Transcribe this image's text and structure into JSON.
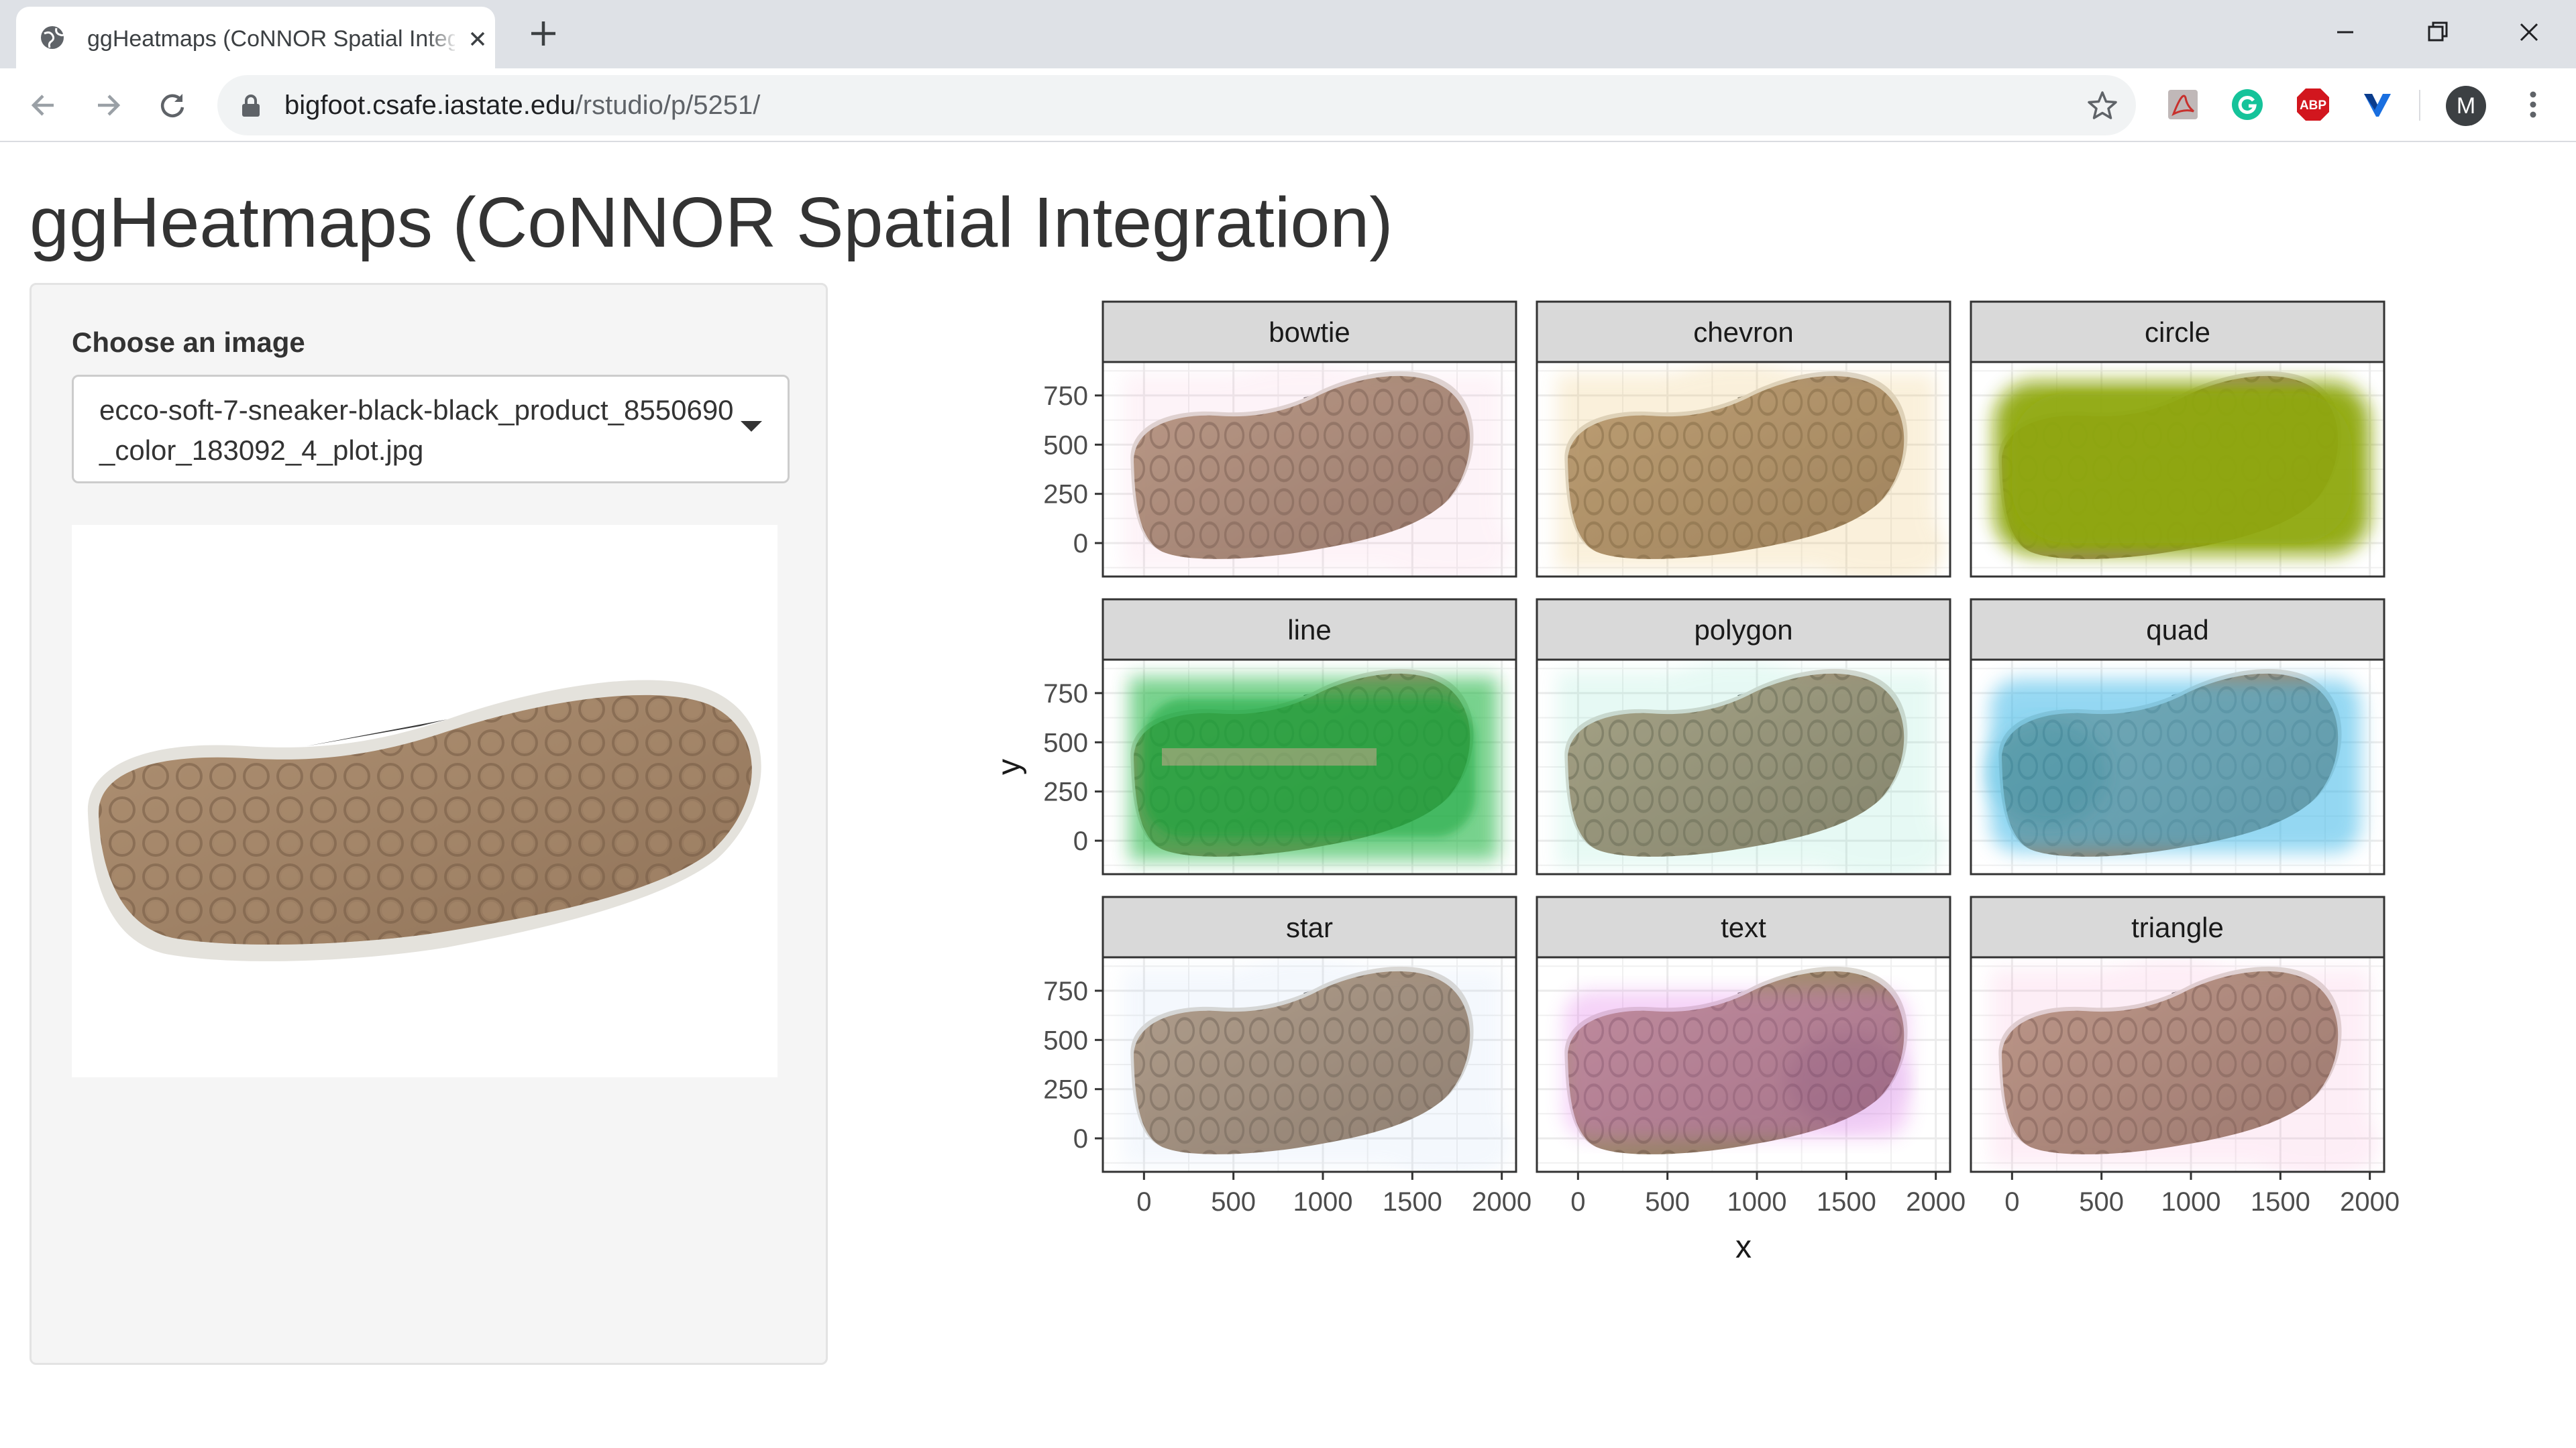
{
  "browser": {
    "tab_title": "ggHeatmaps (CoNNOR Spatial Integration)",
    "url_host": "bigfoot.csafe.iastate.edu",
    "url_path": "/rstudio/p/5251/",
    "avatar_letter": "M"
  },
  "page": {
    "title": "ggHeatmaps (CoNNOR Spatial Integration)"
  },
  "sidebar": {
    "select_label": "Choose an image",
    "select_value": "ecco-soft-7-sneaker-black-black_product_8550690_color_183092_4_plot.jpg"
  },
  "chart_data": {
    "type": "heatmap",
    "xlabel": "x",
    "ylabel": "y",
    "xlim": [
      -230,
      2080
    ],
    "ylim": [
      -170,
      920
    ],
    "x_ticks": [
      0,
      500,
      1000,
      1500,
      2000
    ],
    "y_ticks": [
      0,
      250,
      500,
      750
    ],
    "grid": true,
    "panels": [
      {
        "name": "bowtie",
        "color": "#f4a0c8",
        "intensity": 0.12
      },
      {
        "name": "chevron",
        "color": "#e8b850",
        "intensity": 0.2
      },
      {
        "name": "circle",
        "color": "#8fa80a",
        "intensity": 0.95
      },
      {
        "name": "line",
        "color": "#1fb441",
        "intensity": 0.8
      },
      {
        "name": "polygon",
        "color": "#5fdcb8",
        "intensity": 0.15
      },
      {
        "name": "quad",
        "color": "#3cb8e8",
        "intensity": 0.55
      },
      {
        "name": "star",
        "color": "#a8c8f0",
        "intensity": 0.12
      },
      {
        "name": "text",
        "color": "#e070e8",
        "intensity": 0.3
      },
      {
        "name": "triangle",
        "color": "#f890c8",
        "intensity": 0.15
      }
    ]
  }
}
